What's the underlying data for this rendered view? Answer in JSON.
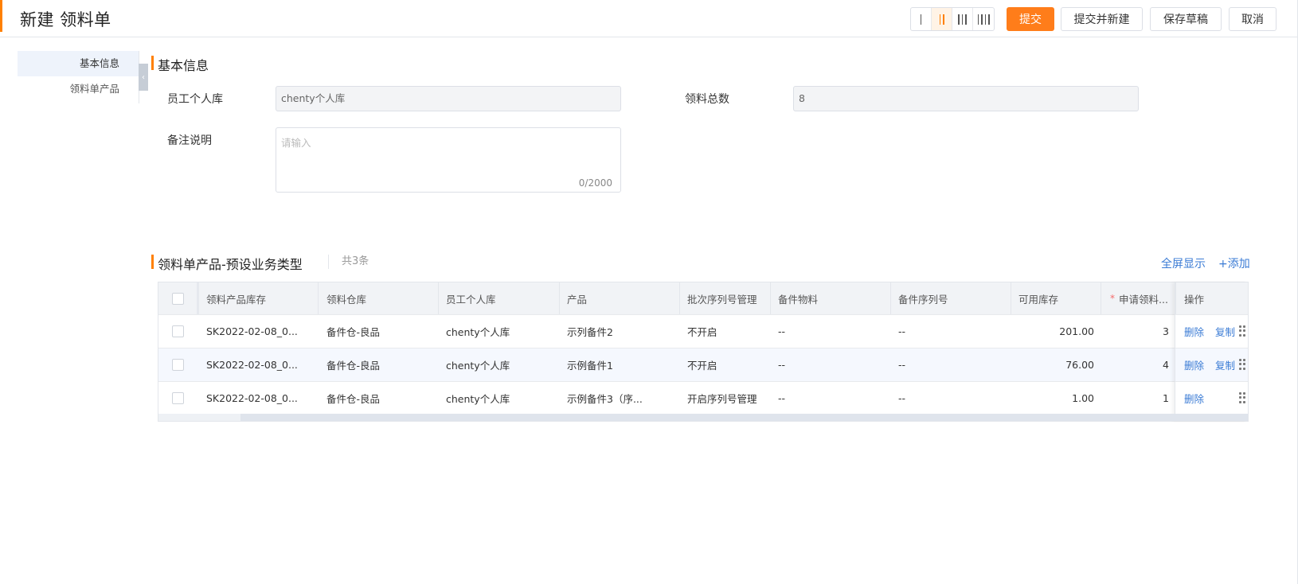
{
  "header": {
    "title": "新建 领料单",
    "buttons": {
      "submit": "提交",
      "submit_new": "提交并新建",
      "save_draft": "保存草稿",
      "cancel": "取消"
    },
    "column_layout_selected": 2
  },
  "anchor_nav": {
    "items": [
      "基本信息",
      "领料单产品"
    ],
    "active": 0
  },
  "basic_info": {
    "title": "基本信息",
    "employee_warehouse_label": "员工个人库",
    "employee_warehouse_value": "chenty个人库",
    "total_label": "领料总数",
    "total_value": "8",
    "remark_label": "备注说明",
    "remark_placeholder": "请输入",
    "remark_count": "0/2000"
  },
  "products": {
    "title": "领料单产品-预设业务类型",
    "count": "共3条",
    "fullscreen": "全屏显示",
    "add": "+添加",
    "columns": [
      "领料产品库存",
      "领料仓库",
      "员工个人库",
      "产品",
      "批次序列号管理",
      "备件物料",
      "备件序列号",
      "可用库存",
      "申请领料...",
      "操作"
    ],
    "rows": [
      {
        "stock": "SK2022-02-08_0...",
        "warehouse": "备件仓-良品",
        "personal": "chenty个人库",
        "product": "示列备件2",
        "batch": "不开启",
        "material": "--",
        "serial": "--",
        "available": "201.00",
        "apply": "3",
        "ops": [
          "删除",
          "复制"
        ]
      },
      {
        "stock": "SK2022-02-08_0...",
        "warehouse": "备件仓-良品",
        "personal": "chenty个人库",
        "product": "示例备件1",
        "batch": "不开启",
        "material": "--",
        "serial": "--",
        "available": "76.00",
        "apply": "4",
        "ops": [
          "删除",
          "复制"
        ]
      },
      {
        "stock": "SK2022-02-08_0...",
        "warehouse": "备件仓-良品",
        "personal": "chenty个人库",
        "product": "示例备件3（序...",
        "batch": "开启序列号管理",
        "material": "--",
        "serial": "--",
        "available": "1.00",
        "apply": "1",
        "ops": [
          "删除"
        ]
      }
    ]
  },
  "colors": {
    "accent": "#ff8000",
    "primary_button": "#ff7d1a",
    "link": "#3a7bd5"
  }
}
